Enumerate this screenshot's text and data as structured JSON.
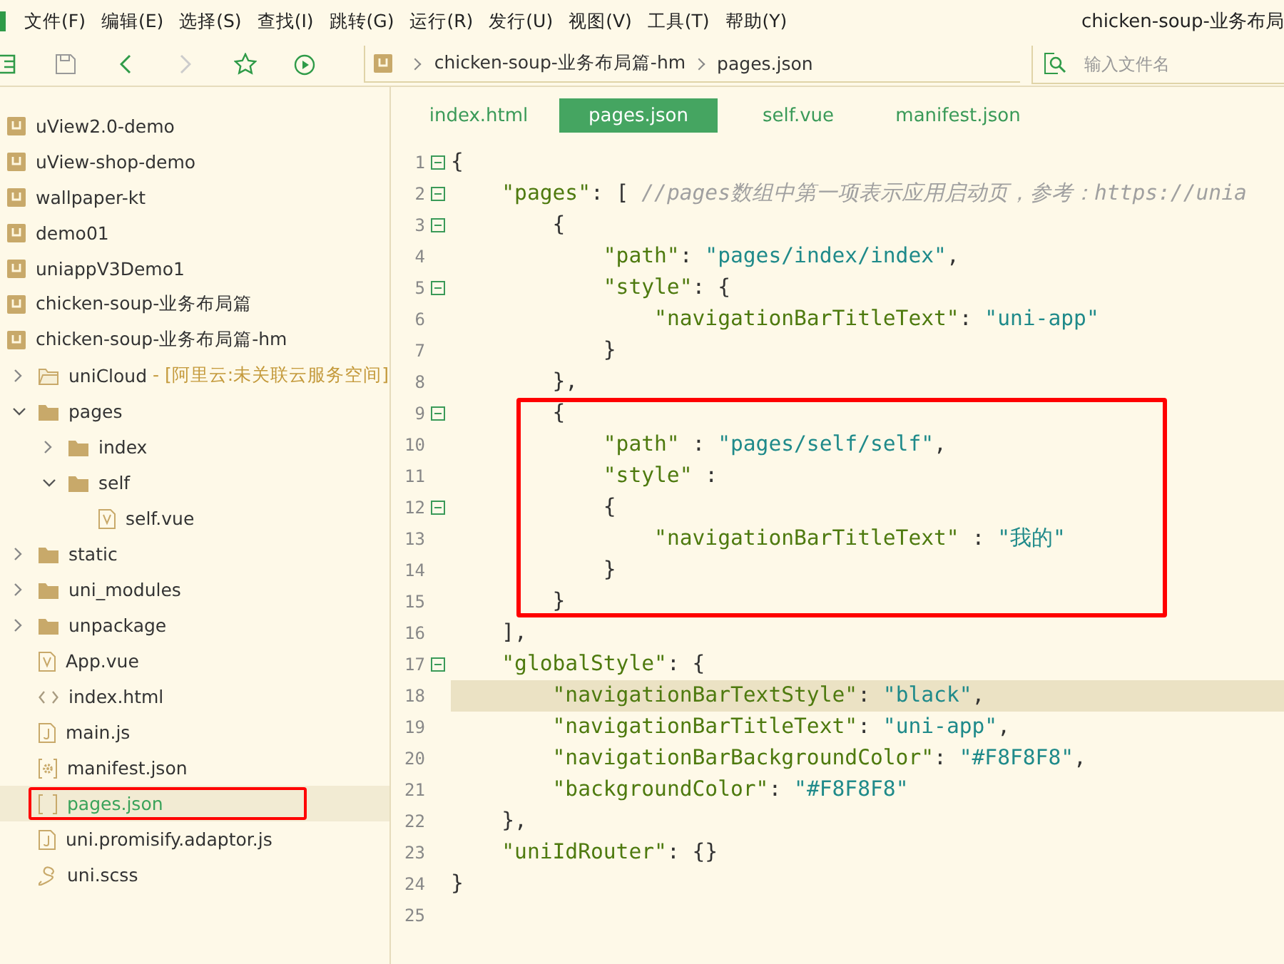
{
  "menu_bar": {
    "items": [
      "文件(F)",
      "编辑(E)",
      "选择(S)",
      "查找(I)",
      "跳转(G)",
      "运行(R)",
      "发行(U)",
      "视图(V)",
      "工具(T)",
      "帮助(Y)"
    ],
    "title": "chicken-soup-业务布局"
  },
  "toolbar": {
    "buttons": [
      {
        "kind": "list",
        "disabled": false
      },
      {
        "kind": "save",
        "disabled": false
      },
      {
        "kind": "back",
        "disabled": false
      },
      {
        "kind": "forward",
        "disabled": true
      },
      {
        "kind": "star",
        "disabled": false
      },
      {
        "kind": "run",
        "disabled": false
      }
    ],
    "breadcrumb": [
      "chicken-soup-业务布局篇-hm",
      "pages.json"
    ],
    "search": {
      "placeholder": "输入文件名"
    }
  },
  "sidebar": {
    "tree": [
      {
        "label": "uView2.0-demo",
        "kind": "project",
        "selected": false,
        "annotated": false
      },
      {
        "label": "uView-shop-demo",
        "kind": "project",
        "selected": false,
        "annotated": false
      },
      {
        "label": "wallpaper-kt",
        "kind": "project",
        "selected": false,
        "annotated": false
      },
      {
        "label": "demo01",
        "kind": "project",
        "selected": false,
        "annotated": false
      },
      {
        "label": "uniappV3Demo1",
        "kind": "project",
        "selected": false,
        "annotated": false
      },
      {
        "label": "chicken-soup-业务布局篇",
        "kind": "project",
        "selected": false,
        "annotated": false
      },
      {
        "label": "chicken-soup-业务布局篇-hm",
        "kind": "project",
        "selected": false,
        "annotated": false,
        "children": [
          {
            "label": "uniCloud",
            "note": "- [阿里云:未关联云服务空间]",
            "kind": "cloud-folder",
            "expanded": false,
            "selected": false,
            "annotated": false
          },
          {
            "label": "pages",
            "kind": "folder",
            "expanded": true,
            "selected": false,
            "annotated": false,
            "children": [
              {
                "label": "index",
                "kind": "folder",
                "expanded": false,
                "selected": false,
                "annotated": false
              },
              {
                "label": "self",
                "kind": "folder",
                "expanded": true,
                "selected": false,
                "annotated": false,
                "children": [
                  {
                    "label": "self.vue",
                    "kind": "vue",
                    "selected": false,
                    "annotated": false
                  }
                ]
              }
            ]
          },
          {
            "label": "static",
            "kind": "folder",
            "expanded": false,
            "selected": false,
            "annotated": false
          },
          {
            "label": "uni_modules",
            "kind": "folder",
            "expanded": false,
            "selected": false,
            "annotated": false
          },
          {
            "label": "unpackage",
            "kind": "folder",
            "expanded": false,
            "selected": false,
            "annotated": false
          },
          {
            "label": "App.vue",
            "kind": "vue",
            "selected": false,
            "annotated": false
          },
          {
            "label": "index.html",
            "kind": "html",
            "selected": false,
            "annotated": false
          },
          {
            "label": "main.js",
            "kind": "js",
            "selected": false,
            "annotated": false
          },
          {
            "label": "manifest.json",
            "kind": "manifest",
            "selected": false,
            "annotated": false
          },
          {
            "label": "pages.json",
            "kind": "json",
            "selected": true,
            "annotated": true
          },
          {
            "label": "uni.promisify.adaptor.js",
            "kind": "js",
            "selected": false,
            "annotated": false
          },
          {
            "label": "uni.scss",
            "kind": "scss",
            "selected": false,
            "annotated": false
          }
        ]
      }
    ]
  },
  "editor": {
    "tabs": [
      {
        "label": "index.html",
        "selected": false
      },
      {
        "label": "pages.json",
        "selected": true
      },
      {
        "label": "self.vue",
        "selected": false
      },
      {
        "label": "manifest.json",
        "selected": false
      }
    ],
    "segments": [
      {
        "annotated": false,
        "lines": [
          {
            "number": "1",
            "fold": true,
            "current": false,
            "tokens": [
              {
                "kind": "p",
                "text": "{"
              }
            ]
          },
          {
            "number": "2",
            "fold": true,
            "current": false,
            "tokens": [
              {
                "kind": "k",
                "text": "\"pages\""
              },
              {
                "kind": "p",
                "text": ": [ "
              },
              {
                "kind": "c",
                "text": "//pages数组中第一项表示应用启动页，参考：https://unia"
              }
            ]
          },
          {
            "number": "3",
            "fold": true,
            "current": false,
            "tokens": [
              {
                "kind": "p",
                "text": "{"
              }
            ]
          },
          {
            "number": "4",
            "fold": false,
            "current": false,
            "tokens": [
              {
                "kind": "k",
                "text": "\"path\""
              },
              {
                "kind": "p",
                "text": ": "
              },
              {
                "kind": "s",
                "text": "\"pages/index/index\""
              },
              {
                "kind": "p",
                "text": ","
              }
            ]
          },
          {
            "number": "5",
            "fold": true,
            "current": false,
            "tokens": [
              {
                "kind": "k",
                "text": "\"style\""
              },
              {
                "kind": "p",
                "text": ": {"
              }
            ]
          },
          {
            "number": "6",
            "fold": false,
            "current": false,
            "tokens": [
              {
                "kind": "k",
                "text": "\"navigationBarTitleText\""
              },
              {
                "kind": "p",
                "text": ": "
              },
              {
                "kind": "s",
                "text": "\"uni-app\""
              }
            ]
          },
          {
            "number": "7",
            "fold": false,
            "current": false,
            "tokens": [
              {
                "kind": "p",
                "text": "}"
              }
            ]
          },
          {
            "number": "8",
            "fold": false,
            "current": false,
            "tokens": [
              {
                "kind": "p",
                "text": "},"
              }
            ]
          }
        ]
      },
      {
        "annotated": true,
        "lines": [
          {
            "number": "9",
            "fold": true,
            "current": false,
            "tokens": [
              {
                "kind": "p",
                "text": "{"
              }
            ]
          },
          {
            "number": "10",
            "fold": false,
            "current": false,
            "tokens": [
              {
                "kind": "k",
                "text": "\"path\""
              },
              {
                "kind": "p",
                "text": " : "
              },
              {
                "kind": "s",
                "text": "\"pages/self/self\""
              },
              {
                "kind": "p",
                "text": ","
              }
            ]
          },
          {
            "number": "11",
            "fold": false,
            "current": false,
            "tokens": [
              {
                "kind": "k",
                "text": "\"style\""
              },
              {
                "kind": "p",
                "text": " :"
              }
            ]
          },
          {
            "number": "12",
            "fold": true,
            "current": false,
            "tokens": [
              {
                "kind": "p",
                "text": "{"
              }
            ]
          },
          {
            "number": "13",
            "fold": false,
            "current": false,
            "tokens": [
              {
                "kind": "k",
                "text": "\"navigationBarTitleText\""
              },
              {
                "kind": "p",
                "text": " : "
              },
              {
                "kind": "s",
                "text": "\"我的\""
              }
            ]
          },
          {
            "number": "14",
            "fold": false,
            "current": false,
            "tokens": [
              {
                "kind": "p",
                "text": "}"
              }
            ]
          },
          {
            "number": "15",
            "fold": false,
            "current": false,
            "tokens": [
              {
                "kind": "p",
                "text": "}"
              }
            ]
          }
        ]
      },
      {
        "annotated": false,
        "lines": [
          {
            "number": "16",
            "fold": false,
            "current": false,
            "tokens": [
              {
                "kind": "p",
                "text": "],"
              }
            ]
          },
          {
            "number": "17",
            "fold": true,
            "current": false,
            "tokens": [
              {
                "kind": "k",
                "text": "\"globalStyle\""
              },
              {
                "kind": "p",
                "text": ": {"
              }
            ]
          },
          {
            "number": "18",
            "fold": false,
            "current": true,
            "tokens": [
              {
                "kind": "k",
                "text": "\"navigationBarTextStyle\""
              },
              {
                "kind": "p",
                "text": ": "
              },
              {
                "kind": "s",
                "text": "\"black\""
              },
              {
                "kind": "p",
                "text": ","
              }
            ]
          },
          {
            "number": "19",
            "fold": false,
            "current": false,
            "tokens": [
              {
                "kind": "k",
                "text": "\"navigationBarTitleText\""
              },
              {
                "kind": "p",
                "text": ": "
              },
              {
                "kind": "s",
                "text": "\"uni-app\""
              },
              {
                "kind": "p",
                "text": ","
              }
            ]
          },
          {
            "number": "20",
            "fold": false,
            "current": false,
            "tokens": [
              {
                "kind": "k",
                "text": "\"navigationBarBackgroundColor\""
              },
              {
                "kind": "p",
                "text": ": "
              },
              {
                "kind": "s",
                "text": "\"#F8F8F8\""
              },
              {
                "kind": "p",
                "text": ","
              }
            ]
          },
          {
            "number": "21",
            "fold": false,
            "current": false,
            "tokens": [
              {
                "kind": "k",
                "text": "\"backgroundColor\""
              },
              {
                "kind": "p",
                "text": ": "
              },
              {
                "kind": "s",
                "text": "\"#F8F8F8\""
              }
            ]
          },
          {
            "number": "22",
            "fold": false,
            "current": false,
            "tokens": [
              {
                "kind": "p",
                "text": "},"
              }
            ]
          },
          {
            "number": "23",
            "fold": false,
            "current": false,
            "tokens": [
              {
                "kind": "k",
                "text": "\"uniIdRouter\""
              },
              {
                "kind": "p",
                "text": ": {}"
              }
            ]
          },
          {
            "number": "24",
            "fold": false,
            "current": false,
            "tokens": [
              {
                "kind": "p",
                "text": "}"
              }
            ]
          },
          {
            "number": "25",
            "fold": false
          }
        ]
      }
    ]
  }
}
